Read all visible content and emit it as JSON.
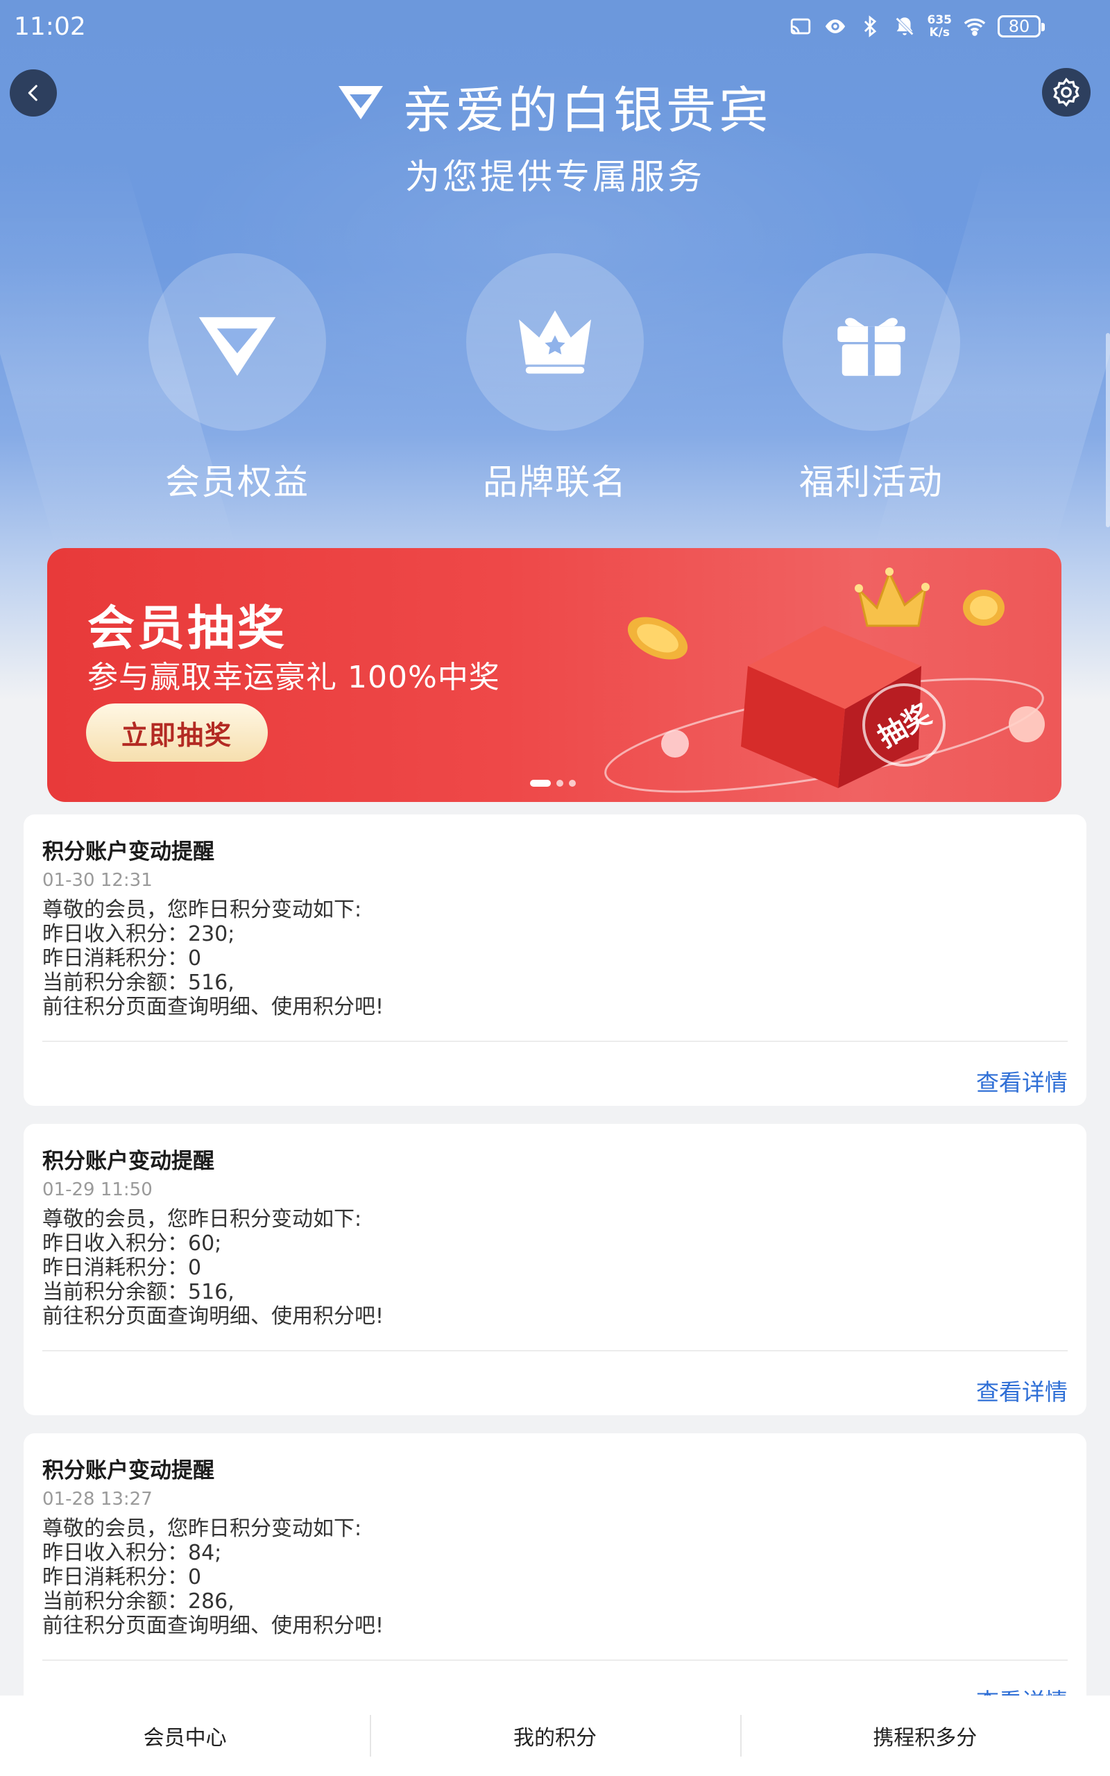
{
  "status_bar": {
    "time": "11:02",
    "speed_value": "635",
    "speed_unit": "K/s",
    "battery": "80",
    "icons": [
      "cast-icon",
      "eye-icon",
      "bluetooth-icon",
      "mute-bell-icon",
      "wifi-icon",
      "battery-icon"
    ]
  },
  "header": {
    "back_icon": "chevron-left-icon",
    "settings_icon": "gear-icon",
    "title": "亲爱的白银贵宾",
    "subtitle": "为您提供专属服务"
  },
  "quick_entries": [
    {
      "label": "会员权益",
      "icon": "diamond-icon"
    },
    {
      "label": "品牌联名",
      "icon": "crown-icon"
    },
    {
      "label": "福利活动",
      "icon": "gift-icon"
    }
  ],
  "banner": {
    "title": "会员抽奖",
    "subtitle": "参与赢取幸运豪礼 100%中奖",
    "button_label": "立即抽奖",
    "box_label": "抽奖",
    "active_dot": 0,
    "dot_count": 3
  },
  "notifications": [
    {
      "title": "积分账户变动提醒",
      "time": "01-30 12:31",
      "lines": [
        "尊敬的会员，您昨日积分变动如下:",
        "昨日收入积分：230;",
        "昨日消耗积分：0",
        "当前积分余额：516,",
        "前往积分页面查询明细、使用积分吧!"
      ],
      "link": "查看详情"
    },
    {
      "title": "积分账户变动提醒",
      "time": "01-29 11:50",
      "lines": [
        "尊敬的会员，您昨日积分变动如下:",
        "昨日收入积分：60;",
        "昨日消耗积分：0",
        "当前积分余额：516,",
        "前往积分页面查询明细、使用积分吧!"
      ],
      "link": "查看详情"
    },
    {
      "title": "积分账户变动提醒",
      "time": "01-28 13:27",
      "lines": [
        "尊敬的会员，您昨日积分变动如下:",
        "昨日收入积分：84;",
        "昨日消耗积分：0",
        "当前积分余额：286,",
        "前往积分页面查询明细、使用积分吧!"
      ],
      "link": "查看详情"
    }
  ],
  "bottom_nav": {
    "tabs": [
      "会员中心",
      "我的积分",
      "携程积多分"
    ]
  },
  "colors": {
    "hero_blue": "#6f9be0",
    "banner_red": "#e83a3a",
    "link_blue": "#2f6fd6",
    "button_text": "#b32a23"
  }
}
